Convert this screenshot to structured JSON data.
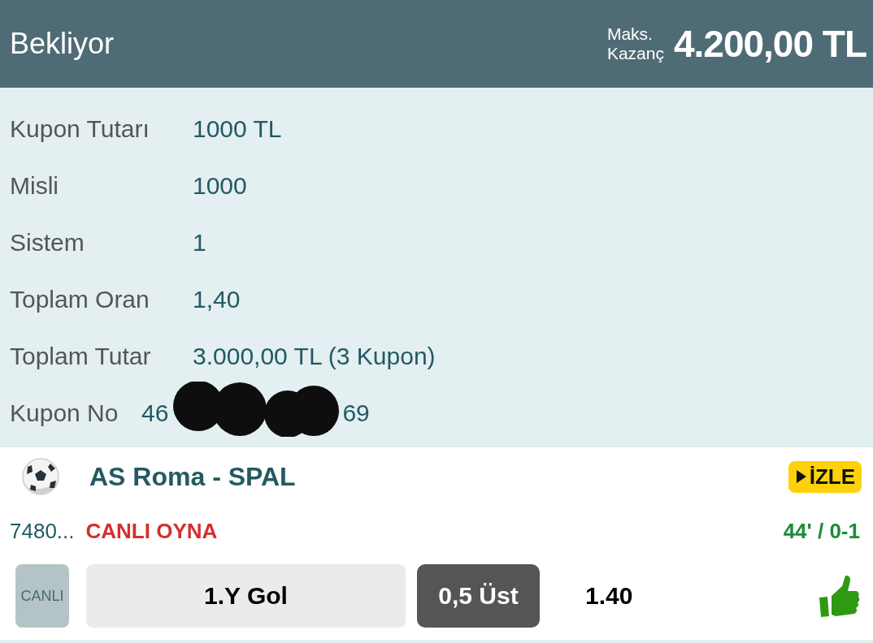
{
  "header": {
    "status": "Bekliyor",
    "max_win_label": "Maks.\nKazanç",
    "max_win": "4.200,00 TL"
  },
  "details": [
    {
      "label": "Kupon Tutarı",
      "value": "1000 TL"
    },
    {
      "label": "Misli",
      "value": "1000"
    },
    {
      "label": "Sistem",
      "value": "1"
    },
    {
      "label": "Toplam Oran",
      "value": "1,40"
    },
    {
      "label": "Toplam Tutar",
      "value": "3.000,00 TL (3 Kupon)"
    }
  ],
  "coupon_no": {
    "label": "Kupon No",
    "value_start": "46",
    "value_end": "69",
    "redacted": true
  },
  "event": {
    "title": "AS Roma - SPAL",
    "watch_button": "İZLE",
    "code": "7480...",
    "live_link": "CANLI OYNA",
    "minute_score": "44' / 0-1",
    "bet": {
      "live_badge": "CANLI",
      "market": "1.Y Gol",
      "selection": "0,5 Üst",
      "odds": "1.40",
      "won": true
    }
  }
}
